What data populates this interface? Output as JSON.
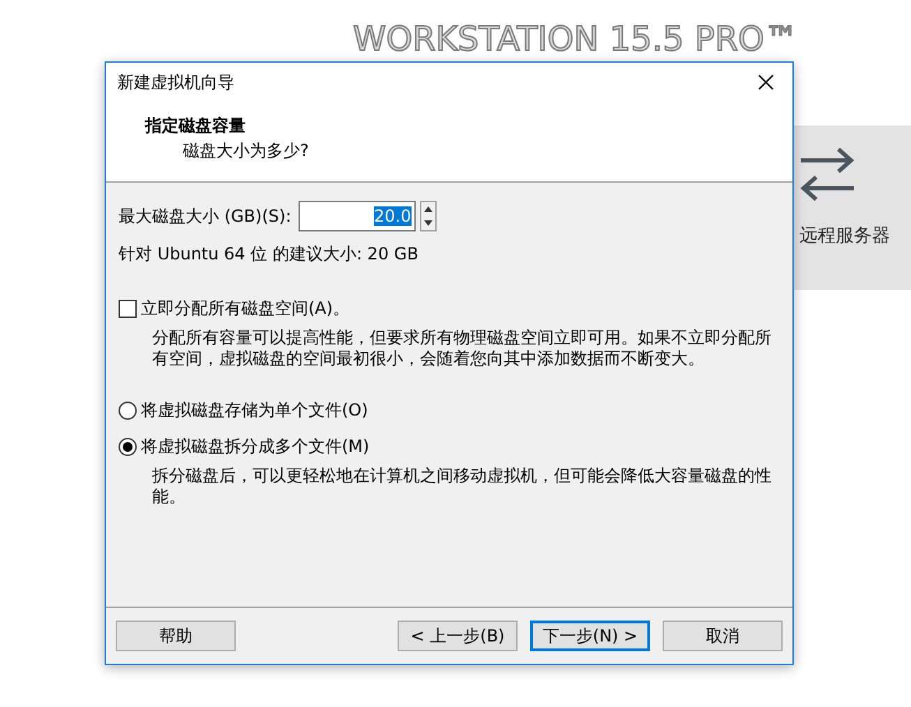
{
  "background": {
    "logo": "WORKSTATION 15.5 PRO™",
    "tile_label": "远程服务器"
  },
  "window": {
    "title": "新建虚拟机向导"
  },
  "header": {
    "title": "指定磁盘容量",
    "subtitle": "磁盘大小为多少?"
  },
  "disk_size": {
    "label": "最大磁盘大小 (GB)(S):",
    "value": "20.0"
  },
  "recommendation": "针对 Ubuntu 64 位 的建议大小: 20 GB",
  "allocate": {
    "label": "立即分配所有磁盘空间(A)。",
    "checked": false,
    "description": "分配所有容量可以提高性能，但要求所有物理磁盘空间立即可用。如果不立即分配所有空间，虚拟磁盘的空间最初很小，会随着您向其中添加数据而不断变大。"
  },
  "storage_options": [
    {
      "label": "将虚拟磁盘存储为单个文件(O)",
      "selected": false
    },
    {
      "label": "将虚拟磁盘拆分成多个文件(M)",
      "selected": true,
      "description": "拆分磁盘后，可以更轻松地在计算机之间移动虚拟机，但可能会降低大容量磁盘的性能。"
    }
  ],
  "buttons": [
    {
      "label": "帮助",
      "default": false
    },
    {
      "label": "< 上一步(B)",
      "default": false
    },
    {
      "label": "下一步(N) >",
      "default": true
    },
    {
      "label": "取消",
      "default": false
    }
  ]
}
